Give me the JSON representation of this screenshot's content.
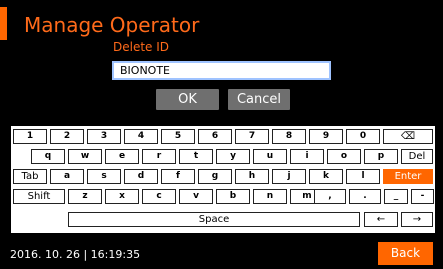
{
  "header": {
    "title": "Manage Operator",
    "subtitle": "Delete ID"
  },
  "id_input": {
    "value": "BIONOTE"
  },
  "dialog": {
    "ok_label": "OK",
    "cancel_label": "Cancel"
  },
  "keyboard": {
    "row1": [
      "1",
      "2",
      "3",
      "4",
      "5",
      "6",
      "7",
      "8",
      "9",
      "0",
      "⌫"
    ],
    "row2": [
      "q",
      "w",
      "e",
      "r",
      "t",
      "y",
      "u",
      "i",
      "o",
      "p",
      "Del"
    ],
    "row3": [
      "Tab",
      "a",
      "s",
      "d",
      "f",
      "g",
      "h",
      "j",
      "k",
      "l",
      "Enter"
    ],
    "row4": [
      "Shift",
      "z",
      "x",
      "c",
      "v",
      "b",
      "n",
      "m",
      ",",
      ".",
      "_",
      "-"
    ],
    "row5": [
      "Space",
      "←",
      "→"
    ]
  },
  "footer": {
    "datetime": "2016. 10. 26  |  16:19:35",
    "back_label": "Back"
  },
  "colors": {
    "accent": "#ff6600",
    "background": "#000000",
    "button": "#6f6f6f"
  }
}
